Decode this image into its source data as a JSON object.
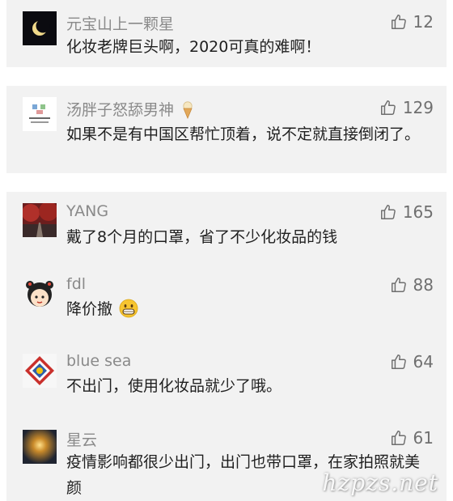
{
  "comments": [
    {
      "user": "元宝山上一颗星",
      "likes": "12",
      "text": "化妆老牌巨头啊，2020可真的难啊！"
    },
    {
      "user": "汤胖子怒舔男神",
      "user_emoji": "ice-cream-icon",
      "likes": "129",
      "text": "如果不是有中国区帮忙顶着，说不定就直接倒闭了。"
    },
    {
      "user": "YANG",
      "likes": "165",
      "text": "戴了8个月的口罩，省了不少化妆品的钱"
    },
    {
      "user": "fdl",
      "likes": "88",
      "text": "降价撤",
      "text_emoji": "grinning-face-icon"
    },
    {
      "user": "blue sea",
      "likes": "64",
      "text": "不出门，使用化妆品就少了哦。"
    },
    {
      "user": "星云",
      "likes": "61",
      "text": "疫情影响都很少出门，出门也带口罩，在家拍照就美颜"
    }
  ],
  "watermark": "hzpzs.net",
  "colors": {
    "card_bg": "#f2f2f2",
    "name": "#8a8a8a",
    "text": "#1f1f1f",
    "like": "#6f6f6f"
  }
}
